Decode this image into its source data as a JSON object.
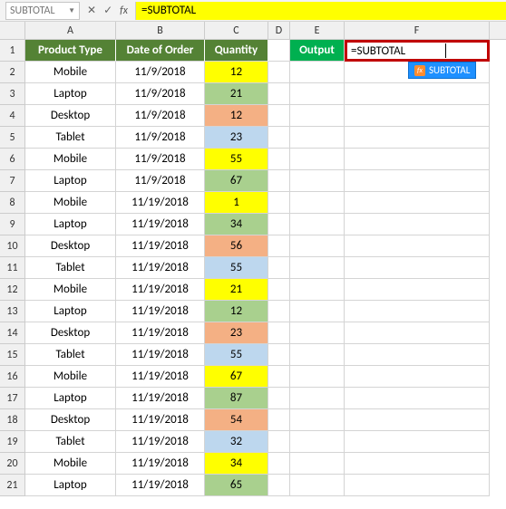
{
  "formula_bar": {
    "name_box": "SUBTOTAL",
    "cancel": "✕",
    "confirm": "✓",
    "fx": "fx",
    "formula": "=SUBTOTAL"
  },
  "columns": [
    "A",
    "B",
    "C",
    "D",
    "E",
    "F"
  ],
  "headers": {
    "A": "Product Type",
    "B": "Date of Order",
    "C": "Quantity"
  },
  "output_label": "Output",
  "active_formula": "=SUBTOTAL",
  "suggestion": "SUBTOTAL",
  "rows": [
    {
      "n": 2,
      "A": "Mobile",
      "B": "11/9/2018",
      "C": "12",
      "cls": "yellow"
    },
    {
      "n": 3,
      "A": "Laptop",
      "B": "11/9/2018",
      "C": "21",
      "cls": "green"
    },
    {
      "n": 4,
      "A": "Desktop",
      "B": "11/9/2018",
      "C": "12",
      "cls": "orange"
    },
    {
      "n": 5,
      "A": "Tablet",
      "B": "11/9/2018",
      "C": "23",
      "cls": "blue"
    },
    {
      "n": 6,
      "A": "Mobile",
      "B": "11/9/2018",
      "C": "55",
      "cls": "yellow"
    },
    {
      "n": 7,
      "A": "Laptop",
      "B": "11/9/2018",
      "C": "67",
      "cls": "green"
    },
    {
      "n": 8,
      "A": "Mobile",
      "B": "11/19/2018",
      "C": "1",
      "cls": "yellow"
    },
    {
      "n": 9,
      "A": "Laptop",
      "B": "11/19/2018",
      "C": "34",
      "cls": "green"
    },
    {
      "n": 10,
      "A": "Desktop",
      "B": "11/19/2018",
      "C": "56",
      "cls": "orange"
    },
    {
      "n": 11,
      "A": "Tablet",
      "B": "11/19/2018",
      "C": "55",
      "cls": "blue"
    },
    {
      "n": 12,
      "A": "Mobile",
      "B": "11/19/2018",
      "C": "21",
      "cls": "yellow"
    },
    {
      "n": 13,
      "A": "Laptop",
      "B": "11/19/2018",
      "C": "12",
      "cls": "green"
    },
    {
      "n": 14,
      "A": "Desktop",
      "B": "11/19/2018",
      "C": "23",
      "cls": "orange"
    },
    {
      "n": 15,
      "A": "Tablet",
      "B": "11/19/2018",
      "C": "55",
      "cls": "blue"
    },
    {
      "n": 16,
      "A": "Mobile",
      "B": "11/19/2018",
      "C": "67",
      "cls": "yellow"
    },
    {
      "n": 17,
      "A": "Laptop",
      "B": "11/19/2018",
      "C": "87",
      "cls": "green"
    },
    {
      "n": 18,
      "A": "Desktop",
      "B": "11/19/2018",
      "C": "54",
      "cls": "orange"
    },
    {
      "n": 19,
      "A": "Tablet",
      "B": "11/19/2018",
      "C": "32",
      "cls": "blue"
    },
    {
      "n": 20,
      "A": "Mobile",
      "B": "11/19/2018",
      "C": "34",
      "cls": "yellow"
    },
    {
      "n": 21,
      "A": "Laptop",
      "B": "11/19/2018",
      "C": "65",
      "cls": "green"
    }
  ],
  "chart_data": {
    "type": "table",
    "title": "",
    "columns": [
      "Product Type",
      "Date of Order",
      "Quantity"
    ],
    "data": [
      [
        "Mobile",
        "11/9/2018",
        12
      ],
      [
        "Laptop",
        "11/9/2018",
        21
      ],
      [
        "Desktop",
        "11/9/2018",
        12
      ],
      [
        "Tablet",
        "11/9/2018",
        23
      ],
      [
        "Mobile",
        "11/9/2018",
        55
      ],
      [
        "Laptop",
        "11/9/2018",
        67
      ],
      [
        "Mobile",
        "11/19/2018",
        1
      ],
      [
        "Laptop",
        "11/19/2018",
        34
      ],
      [
        "Desktop",
        "11/19/2018",
        56
      ],
      [
        "Tablet",
        "11/19/2018",
        55
      ],
      [
        "Mobile",
        "11/19/2018",
        21
      ],
      [
        "Laptop",
        "11/19/2018",
        12
      ],
      [
        "Desktop",
        "11/19/2018",
        23
      ],
      [
        "Tablet",
        "11/19/2018",
        55
      ],
      [
        "Mobile",
        "11/19/2018",
        67
      ],
      [
        "Laptop",
        "11/19/2018",
        87
      ],
      [
        "Desktop",
        "11/19/2018",
        54
      ],
      [
        "Tablet",
        "11/19/2018",
        32
      ],
      [
        "Mobile",
        "11/19/2018",
        34
      ],
      [
        "Laptop",
        "11/19/2018",
        65
      ]
    ]
  }
}
